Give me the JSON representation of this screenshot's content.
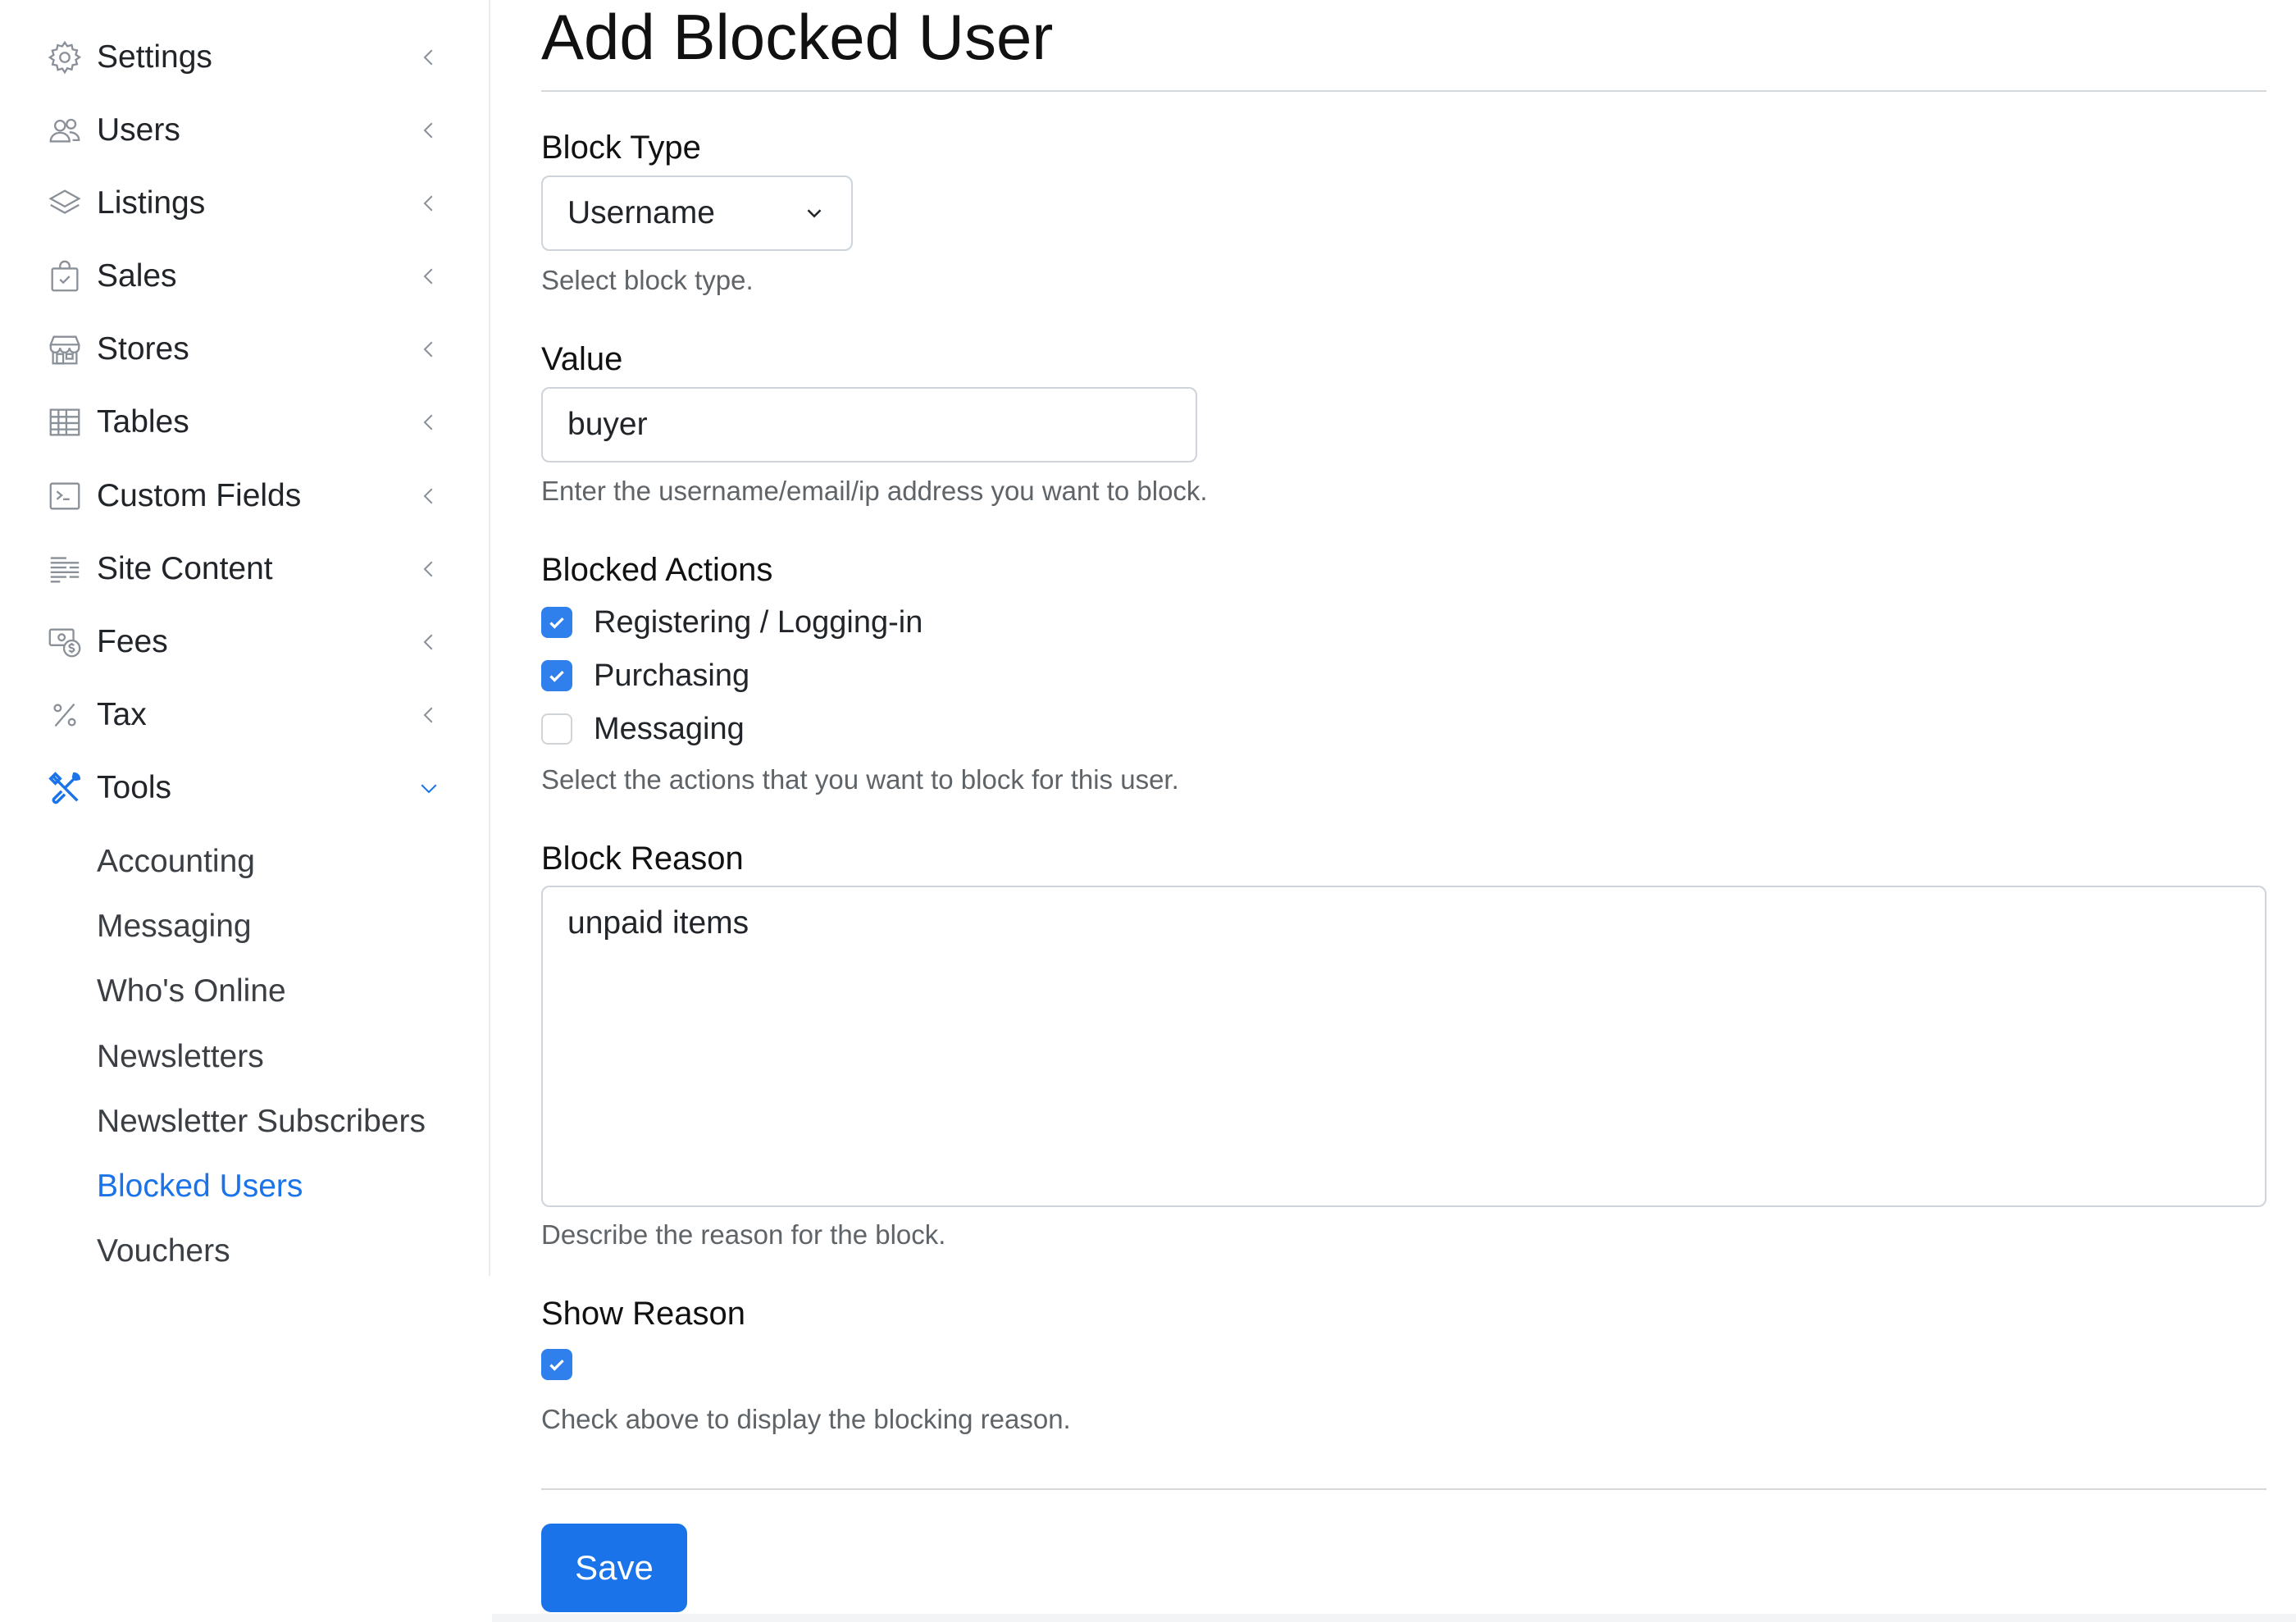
{
  "sidebar": {
    "items": [
      {
        "label": "Settings",
        "icon": "gear-icon"
      },
      {
        "label": "Users",
        "icon": "users-icon"
      },
      {
        "label": "Listings",
        "icon": "layers-icon"
      },
      {
        "label": "Sales",
        "icon": "shopping-bag-icon"
      },
      {
        "label": "Stores",
        "icon": "storefront-icon"
      },
      {
        "label": "Tables",
        "icon": "table-icon"
      },
      {
        "label": "Custom Fields",
        "icon": "terminal-icon"
      },
      {
        "label": "Site Content",
        "icon": "text-lines-icon"
      },
      {
        "label": "Fees",
        "icon": "money-icon"
      },
      {
        "label": "Tax",
        "icon": "percent-icon"
      },
      {
        "label": "Tools",
        "icon": "tools-icon"
      }
    ],
    "sub_items": [
      {
        "label": "Accounting"
      },
      {
        "label": "Messaging"
      },
      {
        "label": "Who's Online"
      },
      {
        "label": "Newsletters"
      },
      {
        "label": "Newsletter Subscribers"
      },
      {
        "label": "Blocked Users"
      },
      {
        "label": "Vouchers"
      }
    ],
    "active_sub_item": "Blocked Users",
    "accent_color": "#1a73e8"
  },
  "form": {
    "title": "Add Blocked User",
    "block_type": {
      "label": "Block Type",
      "value": "Username",
      "help": "Select block type."
    },
    "value": {
      "label": "Value",
      "value": "buyer",
      "help": "Enter the username/email/ip address you want to block."
    },
    "blocked_actions": {
      "label": "Blocked Actions",
      "options": [
        {
          "label": "Registering / Logging-in",
          "checked": true
        },
        {
          "label": "Purchasing",
          "checked": true
        },
        {
          "label": "Messaging",
          "checked": false
        }
      ],
      "help": "Select the actions that you want to block for this user."
    },
    "block_reason": {
      "label": "Block Reason",
      "value": "unpaid items",
      "help": "Describe the reason for the block."
    },
    "show_reason": {
      "label": "Show Reason",
      "checked": true,
      "help": "Check above to display the blocking reason."
    },
    "save_label": "Save",
    "checkbox_color": "#2f80ed"
  }
}
